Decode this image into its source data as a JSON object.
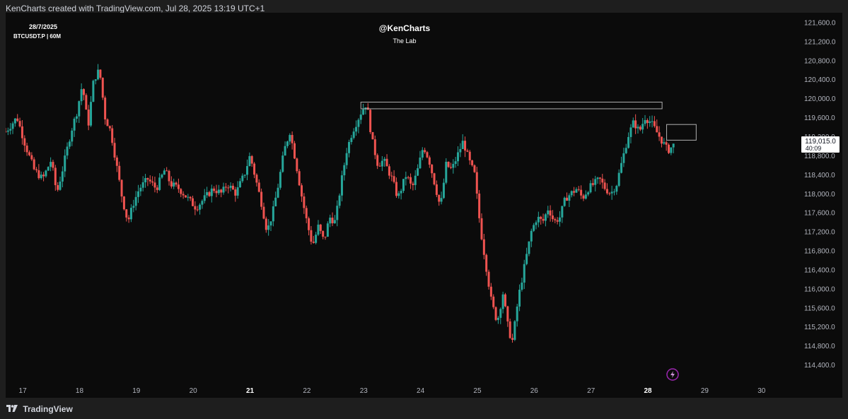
{
  "header": {
    "caption": "KenCharts created with TradingView.com, Jul 28, 2025 13:19 UTC+1"
  },
  "chart_meta": {
    "date": "28/7/2025",
    "symbol": "BTCUSDT.P | 60M",
    "author": "@KenCharts",
    "subtitle": "The Lab",
    "last_price": "119,015.0",
    "countdown": "40:09"
  },
  "footer": {
    "brand": "TradingView"
  },
  "colors": {
    "background": "#0b0b0b",
    "up": "#26a69a",
    "down": "#ef5350",
    "axis_text": "#b2b5be",
    "rect": "#b0b0b0",
    "alert": "#9c27b0"
  },
  "chart_data": {
    "type": "candlestick",
    "title": "",
    "xlabel": "",
    "ylabel": "",
    "ylim": [
      114000,
      121800
    ],
    "xlim": [
      16.7,
      30.7
    ],
    "y_ticks": [
      114400,
      114800,
      115200,
      115600,
      116000,
      116400,
      116800,
      117200,
      117600,
      118000,
      118400,
      118800,
      119200,
      119600,
      120000,
      120400,
      120800,
      121200,
      121600
    ],
    "y_tick_labels": [
      "114,400.0",
      "114,800.0",
      "115,200.0",
      "115,600.0",
      "116,000.0",
      "116,400.0",
      "116,800.0",
      "117,200.0",
      "117,600.0",
      "118,000.0",
      "118,400.0",
      "118,800.0",
      "119,200.0",
      "119,600.0",
      "120,000.0",
      "120,400.0",
      "120,800.0",
      "121,200.0",
      "121,600.0"
    ],
    "x_ticks": [
      17,
      18,
      19,
      20,
      21,
      22,
      23,
      24,
      25,
      26,
      27,
      28,
      29,
      30
    ],
    "x_tick_labels": [
      "17",
      "18",
      "19",
      "20",
      "21",
      "22",
      "23",
      "24",
      "25",
      "26",
      "27",
      "28",
      "29",
      "30"
    ],
    "bold_x_ticks": [
      "21",
      "28"
    ],
    "price_path": [
      [
        16.7,
        119300
      ],
      [
        16.9,
        119600
      ],
      [
        17.05,
        119000
      ],
      [
        17.2,
        118500
      ],
      [
        17.35,
        118300
      ],
      [
        17.5,
        118700
      ],
      [
        17.6,
        118000
      ],
      [
        17.7,
        118500
      ],
      [
        17.85,
        119300
      ],
      [
        17.95,
        119700
      ],
      [
        18.05,
        120300
      ],
      [
        18.15,
        119400
      ],
      [
        18.25,
        120400
      ],
      [
        18.35,
        120600
      ],
      [
        18.45,
        119600
      ],
      [
        18.55,
        119300
      ],
      [
        18.65,
        118600
      ],
      [
        18.75,
        117900
      ],
      [
        18.85,
        117400
      ],
      [
        18.95,
        117800
      ],
      [
        19.05,
        118100
      ],
      [
        19.2,
        118300
      ],
      [
        19.35,
        118100
      ],
      [
        19.5,
        118500
      ],
      [
        19.6,
        118200
      ],
      [
        19.75,
        118100
      ],
      [
        19.9,
        117900
      ],
      [
        20.05,
        117700
      ],
      [
        20.2,
        117900
      ],
      [
        20.35,
        118100
      ],
      [
        20.5,
        118000
      ],
      [
        20.6,
        118200
      ],
      [
        20.75,
        118000
      ],
      [
        20.9,
        118400
      ],
      [
        21.0,
        118800
      ],
      [
        21.1,
        118300
      ],
      [
        21.2,
        117800
      ],
      [
        21.3,
        117200
      ],
      [
        21.4,
        117600
      ],
      [
        21.5,
        118200
      ],
      [
        21.6,
        118900
      ],
      [
        21.7,
        119300
      ],
      [
        21.8,
        118700
      ],
      [
        21.9,
        118000
      ],
      [
        22.0,
        117400
      ],
      [
        22.1,
        116900
      ],
      [
        22.2,
        117300
      ],
      [
        22.3,
        117000
      ],
      [
        22.4,
        117500
      ],
      [
        22.5,
        117400
      ],
      [
        22.6,
        118200
      ],
      [
        22.7,
        118900
      ],
      [
        22.8,
        119300
      ],
      [
        22.95,
        119700
      ],
      [
        23.05,
        119900
      ],
      [
        23.15,
        119100
      ],
      [
        23.25,
        118600
      ],
      [
        23.35,
        118700
      ],
      [
        23.5,
        118300
      ],
      [
        23.6,
        117900
      ],
      [
        23.75,
        118400
      ],
      [
        23.85,
        118100
      ],
      [
        23.95,
        118500
      ],
      [
        24.05,
        119000
      ],
      [
        24.15,
        118700
      ],
      [
        24.25,
        118200
      ],
      [
        24.35,
        117700
      ],
      [
        24.45,
        118600
      ],
      [
        24.55,
        118500
      ],
      [
        24.65,
        118800
      ],
      [
        24.75,
        119100
      ],
      [
        24.85,
        118700
      ],
      [
        24.95,
        118400
      ],
      [
        25.05,
        117300
      ],
      [
        25.15,
        116500
      ],
      [
        25.25,
        115700
      ],
      [
        25.35,
        115300
      ],
      [
        25.45,
        115900
      ],
      [
        25.55,
        115100
      ],
      [
        25.62,
        114900
      ],
      [
        25.72,
        115800
      ],
      [
        25.85,
        116600
      ],
      [
        25.95,
        117200
      ],
      [
        26.05,
        117500
      ],
      [
        26.15,
        117400
      ],
      [
        26.25,
        117700
      ],
      [
        26.35,
        117400
      ],
      [
        26.45,
        117500
      ],
      [
        26.55,
        117900
      ],
      [
        26.65,
        118000
      ],
      [
        26.75,
        118100
      ],
      [
        26.85,
        117900
      ],
      [
        26.95,
        118100
      ],
      [
        27.05,
        118200
      ],
      [
        27.15,
        118300
      ],
      [
        27.25,
        118100
      ],
      [
        27.35,
        118000
      ],
      [
        27.45,
        118200
      ],
      [
        27.55,
        118700
      ],
      [
        27.65,
        119200
      ],
      [
        27.75,
        119500
      ],
      [
        27.85,
        119300
      ],
      [
        27.95,
        119600
      ],
      [
        28.05,
        119500
      ],
      [
        28.15,
        119300
      ],
      [
        28.25,
        119100
      ],
      [
        28.35,
        118900
      ],
      [
        28.45,
        119015
      ]
    ],
    "rectangles": [
      {
        "x0": 22.95,
        "x1": 28.25,
        "y0": 119780,
        "y1": 119920
      },
      {
        "x0": 28.33,
        "x1": 28.85,
        "y0": 119120,
        "y1": 119450
      }
    ]
  }
}
